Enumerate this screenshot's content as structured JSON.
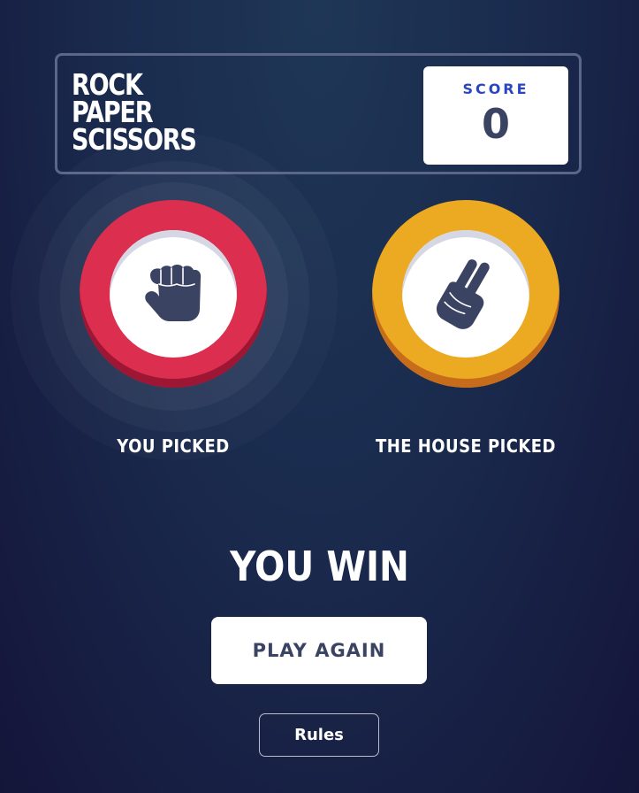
{
  "header": {
    "logo_lines": [
      "ROCK",
      "PAPER",
      "SCISSORS"
    ],
    "score_label": "SCORE",
    "score_value": "0"
  },
  "player": {
    "label": "YOU PICKED",
    "choice": "rock",
    "icon": "rock-fist-icon",
    "ring_color": "#dc2e4e",
    "winner": true
  },
  "house": {
    "label": "THE HOUSE PICKED",
    "choice": "scissors",
    "icon": "scissors-hand-icon",
    "ring_color": "#eca922"
  },
  "result": {
    "text": "YOU WIN",
    "play_again_label": "PLAY AGAIN"
  },
  "footer": {
    "rules_label": "Rules"
  },
  "colors": {
    "background_top": "#1f3756",
    "background_bottom": "#141539",
    "score_label": "#2a45c2",
    "dark_text": "#3b4363",
    "header_border": "#5b6689"
  }
}
